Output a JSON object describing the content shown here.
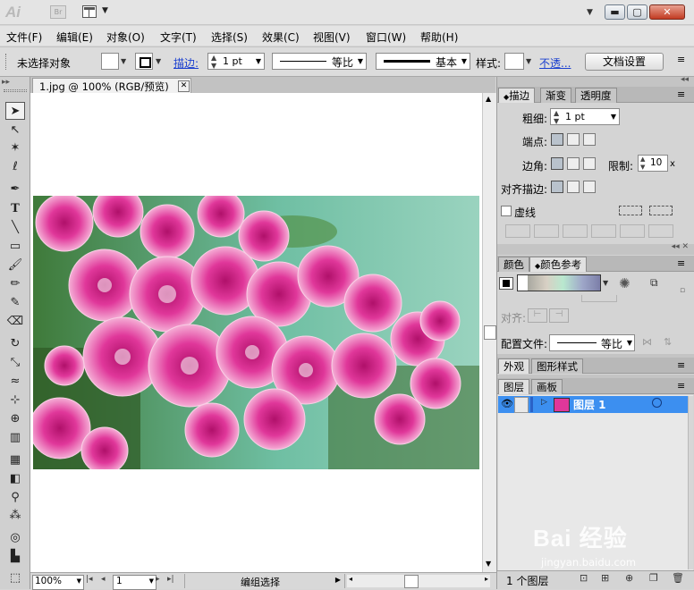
{
  "app": {
    "logo": "Ai",
    "bridge": "Br"
  },
  "window_buttons": {
    "minimize": "▬",
    "restore": "▢",
    "close": "✕"
  },
  "menu": [
    "文件(F)",
    "编辑(E)",
    "对象(O)",
    "文字(T)",
    "选择(S)",
    "效果(C)",
    "视图(V)",
    "窗口(W)",
    "帮助(H)"
  ],
  "control": {
    "selection": "未选择对象",
    "stroke_label": "描边:",
    "stroke_weight": "1 pt",
    "stroke_profile": "等比",
    "brush": "基本",
    "style_label": "样式:",
    "opacity_link": "不透...",
    "doc_setup": "文档设置"
  },
  "document": {
    "tab_title": "1.jpg @ 100% (RGB/预览)",
    "zoom": "100%",
    "page": "1",
    "status": "编组选择"
  },
  "stroke_panel": {
    "tabs": [
      "描边",
      "渐变",
      "透明度"
    ],
    "weight_label": "粗细:",
    "weight_value": "1 pt",
    "cap_label": "端点:",
    "corner_label": "边角:",
    "limit_label": "限制:",
    "limit_value": "10",
    "align_label": "对齐描边:",
    "dashed_label": "虚线"
  },
  "color_panel": {
    "tabs": [
      "颜色",
      "颜色参考"
    ],
    "align_label": "对齐:",
    "profile_label": "配置文件:",
    "profile_value": "等比"
  },
  "appearance_panel": {
    "tabs": [
      "外观",
      "图形样式"
    ]
  },
  "layers_panel": {
    "tabs": [
      "图层",
      "画板"
    ],
    "layers": [
      {
        "name": "图层 1",
        "color": "#3b82f0"
      }
    ],
    "footer": "1 个图层"
  },
  "watermark": {
    "brand": "Bai 经验",
    "url": "jingyan.baidu.com"
  },
  "colors": {
    "selection_blue": "#3c8ff0",
    "flower_pink": "#e0379a"
  }
}
